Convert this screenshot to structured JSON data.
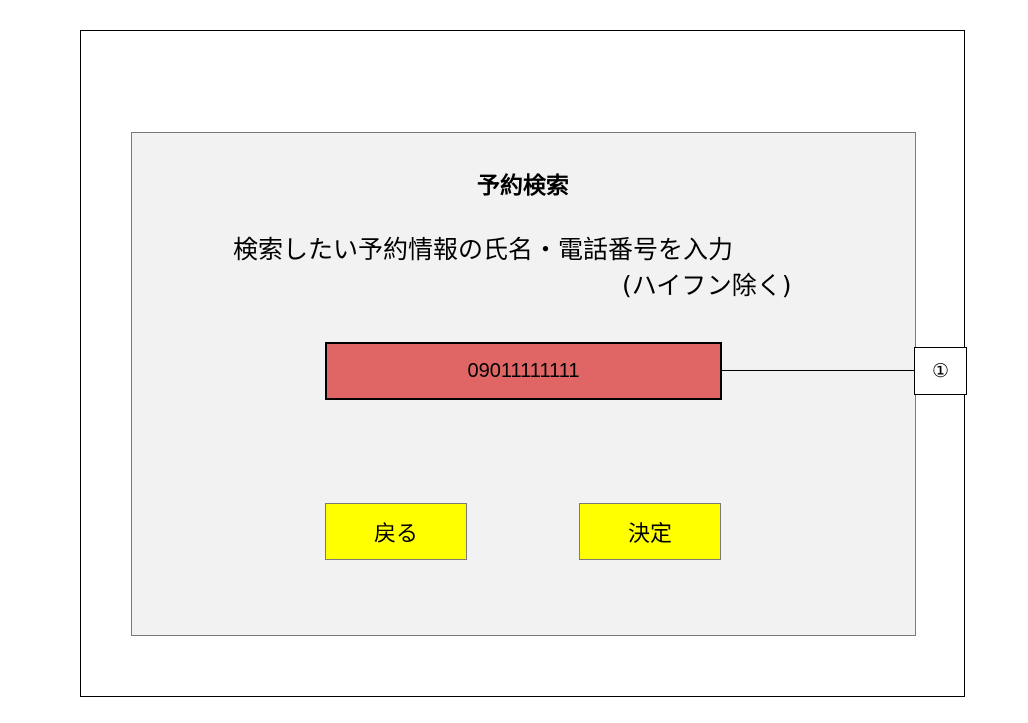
{
  "screen": {
    "title": "予約検索",
    "instruction_line1": "検索したい予約情報の氏名・電話番号を入力",
    "instruction_line2": "(ハイフン除く)"
  },
  "phone_field": {
    "value": "09011111111",
    "fill_color": "#e06666"
  },
  "annotation": {
    "marker": "①"
  },
  "buttons": {
    "back_label": "戻る",
    "confirm_label": "決定",
    "fill_color": "#ffff00"
  }
}
